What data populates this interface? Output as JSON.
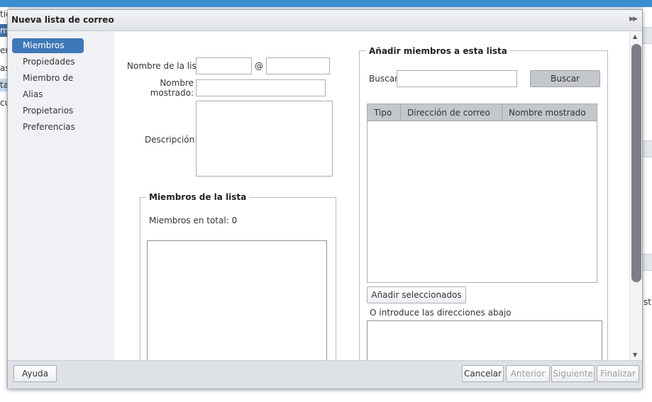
{
  "background": {
    "left_fragments": [
      "tic",
      "mi",
      "er",
      "as",
      "ta",
      "cu"
    ],
    "right_fragment": "st"
  },
  "dialog": {
    "title": "Nueva lista de correo",
    "title_icon": "expand-arrows-icon"
  },
  "sidebar": {
    "items": [
      {
        "label": "Miembros",
        "active": true
      },
      {
        "label": "Propiedades"
      },
      {
        "label": "Miembro de"
      },
      {
        "label": "Alias"
      },
      {
        "label": "Propietarios"
      },
      {
        "label": "Preferencias"
      }
    ]
  },
  "form": {
    "list_name_label": "Nombre de la lista",
    "at_sign": "@",
    "list_name_value": "",
    "domain_value": "",
    "display_name_label_line1": "Nombre",
    "display_name_label_line2": "mostrado:",
    "display_name_value": "",
    "description_label": "Descripción:",
    "description_value": ""
  },
  "members": {
    "legend": "Miembros de la lista",
    "total_text": "Miembros en total: 0"
  },
  "add_members": {
    "legend": "Añadir miembros a esta lista",
    "search_label": "Buscar",
    "search_value": "",
    "search_button": "Buscar",
    "columns": [
      "Tipo",
      "Dirección de correo",
      "Nombre mostrado"
    ],
    "add_selected_button": "Añadir seleccionados",
    "manual_label": "O introduce las direcciones abajo",
    "manual_value": ""
  },
  "footer": {
    "help": "Ayuda",
    "cancel": "Cancelar",
    "previous": "Anterior",
    "next": "Siguiente",
    "finish": "Finalizar"
  },
  "colors": {
    "accent": "#3e78b8",
    "header_gray": "#c4c7cb"
  }
}
